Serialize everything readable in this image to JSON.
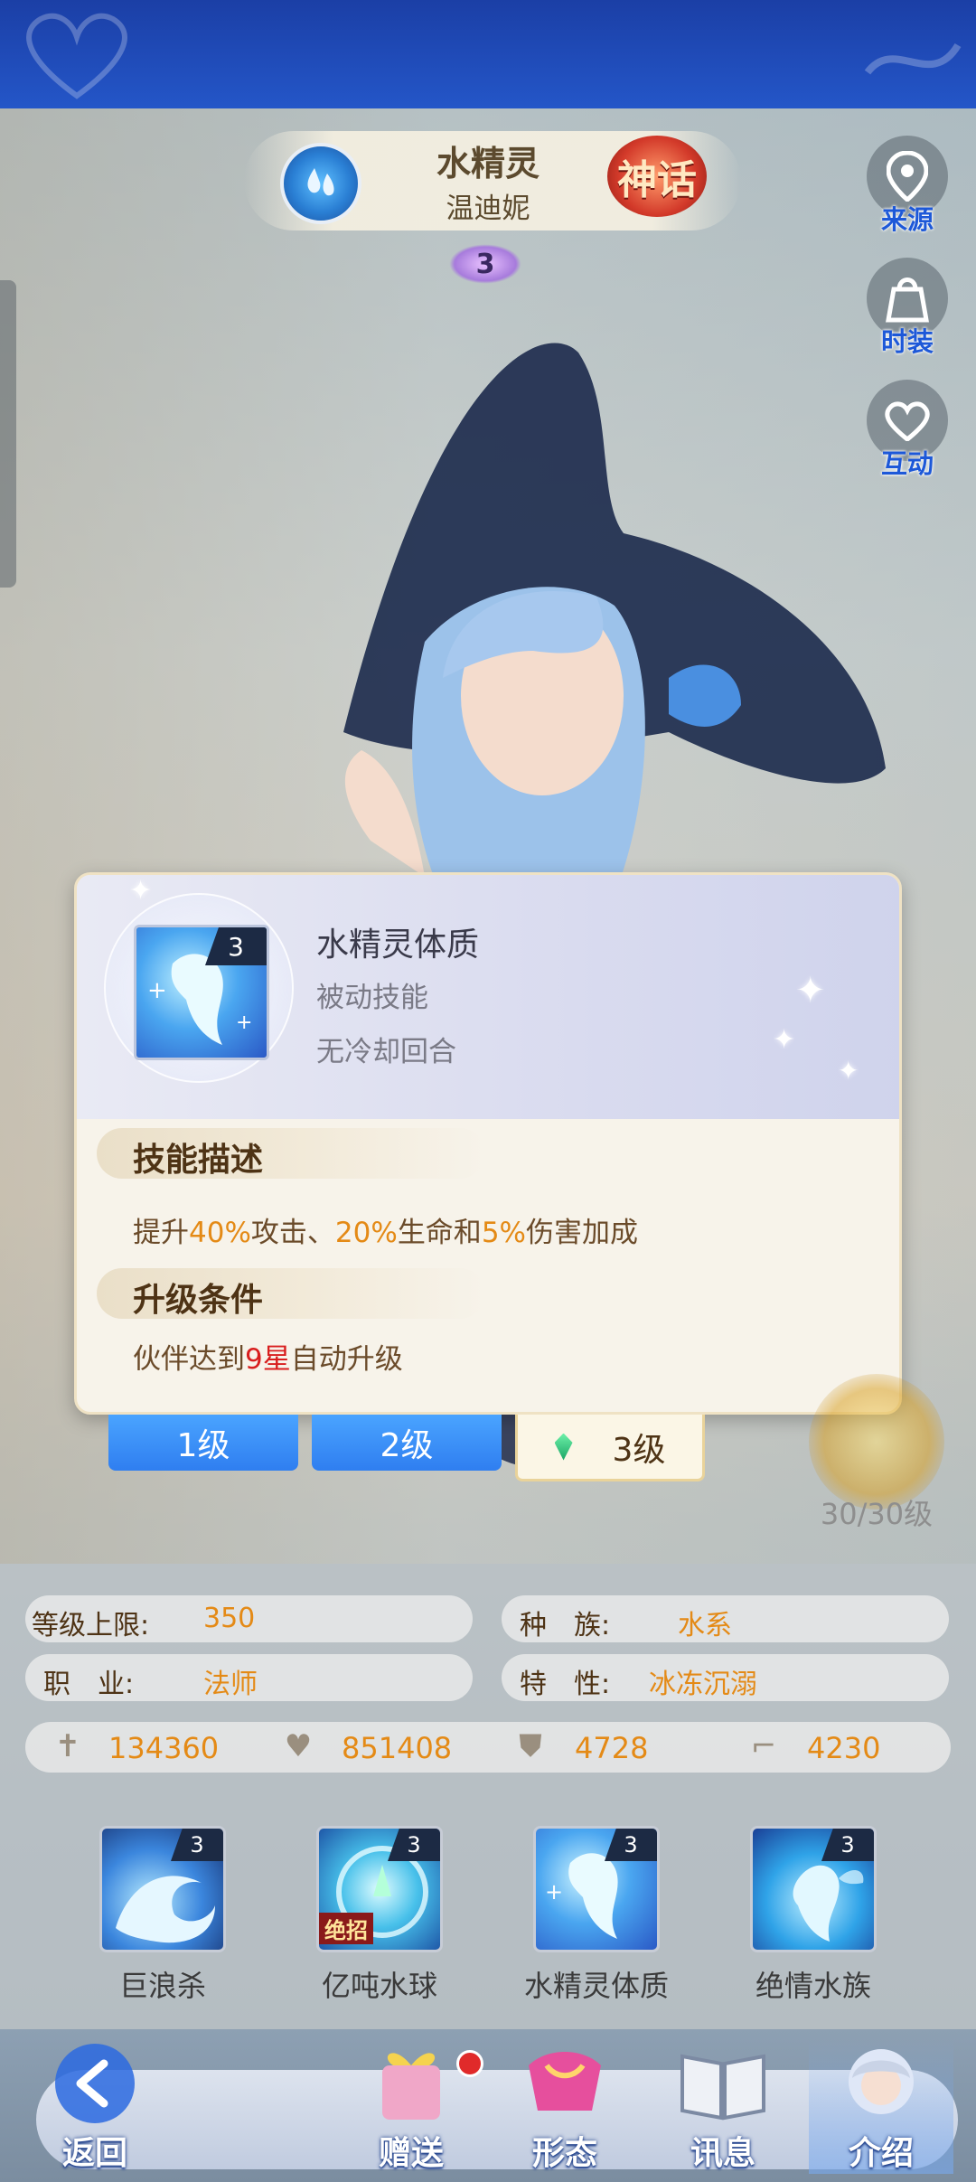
{
  "hero": {
    "name": "水精灵",
    "sub_name": "温迪妮",
    "rarity_badge": "神话",
    "star": "3"
  },
  "side_buttons": [
    {
      "label": "来源",
      "icon": "location-pin-icon"
    },
    {
      "label": "时装",
      "icon": "gift-bag-icon"
    },
    {
      "label": "互动",
      "icon": "heart-icon"
    }
  ],
  "skill_popup": {
    "title": "水精灵体质",
    "type": "被动技能",
    "cooldown": "无冷却回合",
    "level_tag": "3",
    "section_desc": "技能描述",
    "desc": {
      "p1": "提升",
      "v1": "40%",
      "p2": "攻击、",
      "v2": "20%",
      "p3": "生命和",
      "v3": "5%",
      "p4": "伤害加成"
    },
    "section_upgrade": "升级条件",
    "upgrade": {
      "p1": "伙伴达到",
      "v1": "9星",
      "p2": "自动升级"
    }
  },
  "level_tabs": [
    {
      "label": "1级"
    },
    {
      "label": "2级"
    },
    {
      "label": "3级"
    }
  ],
  "level_progress": "30/30级",
  "stats": {
    "level_cap_label": "等级上限:",
    "level_cap_value": "350",
    "race_label": "种　族:",
    "race_value": "水系",
    "job_label": "职　业:",
    "job_value": "法师",
    "trait_label": "特　性:",
    "trait_value": "冰冻沉溺"
  },
  "attributes": [
    {
      "icon": "sword-icon",
      "value": "134360"
    },
    {
      "icon": "heart-icon",
      "value": "851408"
    },
    {
      "icon": "shield-icon",
      "value": "4728"
    },
    {
      "icon": "boot-icon",
      "value": "4230"
    }
  ],
  "skills": [
    {
      "name": "巨浪杀",
      "level": "3"
    },
    {
      "name": "亿吨水球",
      "level": "3",
      "badge": "绝招"
    },
    {
      "name": "水精灵体质",
      "level": "3"
    },
    {
      "name": "绝情水族",
      "level": "3"
    }
  ],
  "nav": {
    "back": "返回",
    "gift": "赠送",
    "form": "形态",
    "info": "讯息",
    "intro": "介绍"
  }
}
